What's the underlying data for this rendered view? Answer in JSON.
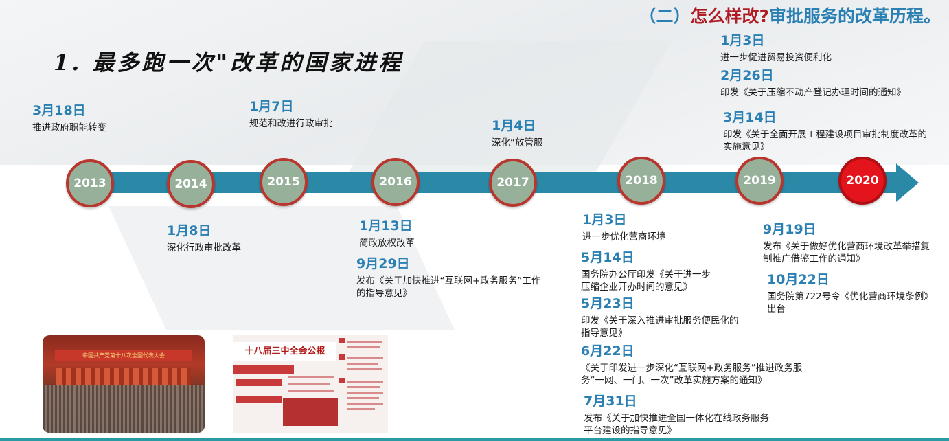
{
  "header": {
    "paren": "（二）",
    "how": "怎么样改?",
    "title": "审批服务的改革历程。"
  },
  "section_title": "1. 最多跑一次\"改革的国家进程",
  "years": [
    "2013",
    "2014",
    "2015",
    "2016",
    "2017",
    "2018",
    "2019",
    "2020"
  ],
  "events": [
    {
      "date": "3月18日",
      "text": "推进政府职能转变"
    },
    {
      "date": "1月7日",
      "text": "规范和改进行政审批"
    },
    {
      "date": "1月4日",
      "text": "深化“放管服"
    },
    {
      "date": "1月8日",
      "text": "深化行政审批改革"
    },
    {
      "date": "1月13日",
      "text": "简政放权改革"
    },
    {
      "date": "9月29日",
      "text": "发布《关于加快推进“互联网+政务服务”工作的指导意见》"
    },
    {
      "date": "1月3日",
      "text": "进一步优化营商环境"
    },
    {
      "date": "5月14日",
      "text": "国务院办公厅印发《关于进一步压缩企业开办时间的意见》"
    },
    {
      "date": "5月23日",
      "text": "印发《关于深入推进审批服务便民化的指导意见》"
    },
    {
      "date": "6月22日",
      "text": "《关于印发进一步深化“互联网+政务服务”推进政务服务“一网、一门、一次”改革实施方案的通知》"
    },
    {
      "date": "7月31日",
      "text": "发布《关于加快推进全国一体化在线政务服务平台建设的指导意见》"
    },
    {
      "date": "1月3日",
      "text": "进一步促进贸易投资便利化"
    },
    {
      "date": "2月26日",
      "text": "印发《关于压缩不动产登记办理时间的通知》"
    },
    {
      "date": "3月14日",
      "text": "印发《关于全面开展工程建设项目审批制度改革的实施意见》"
    },
    {
      "date": "9月19日",
      "text": "发布《关于做好优化营商环境改革举措复制推广借鉴工作的通知》"
    },
    {
      "date": "10月22日",
      "text": "国务院第722号令《优化营商环境条例》出台"
    }
  ],
  "images": {
    "congress_banner": "中国共产党第十八次全国代表大会",
    "communique_head": "十八届三中全会公报"
  },
  "colors": {
    "accent_blue": "#2a7fb3",
    "accent_red": "#b01c23",
    "timeline": "#2a89a7",
    "node": "#97b09a",
    "node_current": "#e3141b"
  }
}
